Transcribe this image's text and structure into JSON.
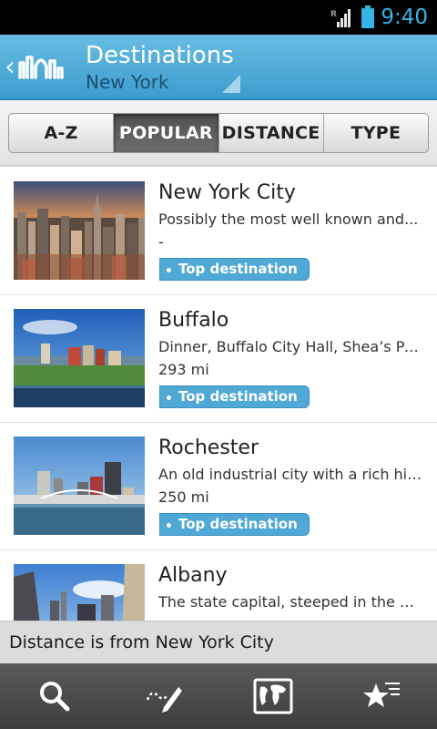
{
  "status_bar": {
    "time": "9:40",
    "signal_label": "R",
    "accent_color": "#33b5e5"
  },
  "header": {
    "back_glyph": "‹",
    "logo_icon": "skyline-logo-icon",
    "title": "Destinations",
    "subtitle": "New York"
  },
  "tabs": [
    {
      "label": "A-Z",
      "active": false
    },
    {
      "label": "POPULAR",
      "active": true
    },
    {
      "label": "DISTANCE",
      "active": false
    },
    {
      "label": "TYPE",
      "active": false
    }
  ],
  "destinations": [
    {
      "name": "New York City",
      "description": "Possibly the most well known and...",
      "distance": "-",
      "badge": "Top destination",
      "thumbnail": "city-skyline-sunset"
    },
    {
      "name": "Buffalo",
      "description": "Dinner, Buffalo City Hall, Shea’s Per...",
      "distance": "293 mi",
      "badge": "Top destination",
      "thumbnail": "buffalo-waterfront"
    },
    {
      "name": "Rochester",
      "description": "An old industrial city with a rich his...",
      "distance": "250 mi",
      "badge": "Top destination",
      "thumbnail": "rochester-river-skyline"
    },
    {
      "name": "Albany",
      "description": "The state capital, steeped in the his...",
      "distance": "",
      "badge": "",
      "thumbnail": "albany-towers"
    }
  ],
  "footer_note": "Distance is from New York City",
  "bottom_nav": [
    {
      "icon": "search-icon"
    },
    {
      "icon": "journal-pen-icon"
    },
    {
      "icon": "world-map-icon"
    },
    {
      "icon": "starred-icon"
    }
  ],
  "colors": {
    "title_bar": "#4aa8d6",
    "badge": "#4fa8d6",
    "active_tab": "#555555"
  }
}
